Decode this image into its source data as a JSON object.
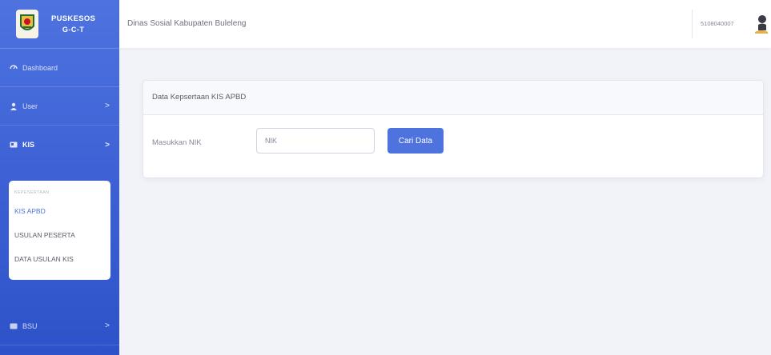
{
  "sidebar": {
    "brand_title": "PUSKESOS",
    "brand_sub": "G-C-T",
    "items": [
      {
        "label": "Dashboard",
        "icon": "dashboard-icon"
      },
      {
        "label": "User",
        "icon": "user-icon",
        "chevron": ">"
      },
      {
        "label": "KIS",
        "icon": "kis-icon",
        "chevron": ">"
      },
      {
        "label": "BSU",
        "icon": "bsu-icon",
        "chevron": ">"
      }
    ],
    "submenu": {
      "header": "KEPESERTAAN",
      "items": [
        "KIS APBD",
        "USULAN PESERTA",
        "DATA USULAN KIS"
      ]
    }
  },
  "topbar": {
    "org_name": "Dinas Sosial Kabupaten Buleleng",
    "user_id": "5108040007"
  },
  "card": {
    "title": "Data Kepsertaan KIS APBD",
    "form_label": "Masukkan NIK",
    "nik_placeholder": "NIK",
    "button_label": "Cari Data"
  },
  "colors": {
    "primary": "#4e73df",
    "sidebar_bottom": "#2d52c9"
  }
}
